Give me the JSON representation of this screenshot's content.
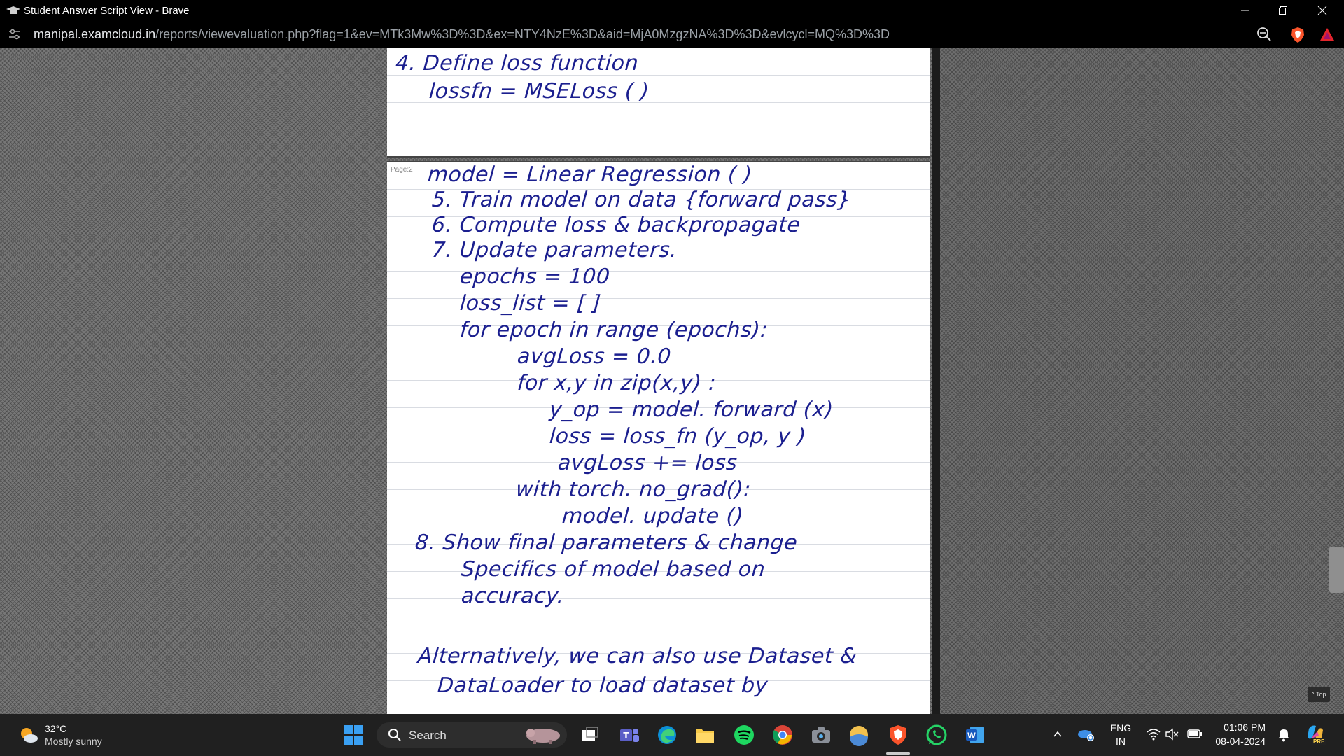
{
  "window": {
    "title": "Student Answer Script View - Brave"
  },
  "address": {
    "host": "manipal.examcloud.in",
    "path": "/reports/viewevaluation.php?flag=1&ev=MTk3Mw%3D%3D&ex=NTY4NzE%3D&aid=MjA0MzgzNA%3D%3D&evlcycl=MQ%3D%3D"
  },
  "page1": {
    "lines": [
      "4. Define loss function",
      "lossfn = MSELoss ( )"
    ]
  },
  "page2": {
    "label": "Page:2",
    "lines": [
      "model = Linear Regression ( )",
      "5. Train model on data {forward pass}",
      "6. Compute loss & backpropagate",
      "7. Update parameters.",
      "epochs = 100",
      "loss_list = [ ]",
      "for epoch in range (epochs):",
      "avgLoss = 0.0",
      "for x,y in zip(x,y) :",
      "y_op = model. forward (x)",
      "loss = loss_fn (y_op, y )",
      "avgLoss += loss",
      "with torch. no_grad():",
      "model. update ()",
      "8. Show final parameters & change",
      "Specifics of model based on",
      "accuracy.",
      "Alternatively, we can also use Dataset &",
      "DataLoader to load dataset by"
    ]
  },
  "top_button": "^ Top",
  "taskbar": {
    "weather_temp": "32°C",
    "weather_desc": "Mostly sunny",
    "search_label": "Search",
    "lang_1": "ENG",
    "lang_2": "IN",
    "time": "01:06 PM",
    "date": "08-04-2024",
    "copilot_badge": "PRE"
  }
}
